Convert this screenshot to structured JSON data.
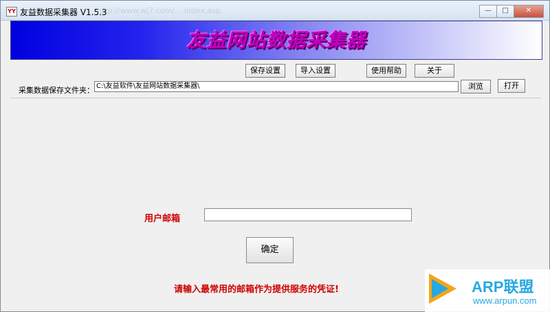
{
  "window": {
    "title": "友益数据采集器 V1.5.3",
    "title_ghost": "http://www.wj7.com/... index.asp",
    "minimize_glyph": "—",
    "maximize_glyph": "□",
    "close_glyph": "✕"
  },
  "banner": {
    "title": "友益网站数据采集器"
  },
  "toolbar": {
    "save_settings": "保存设置",
    "import_settings": "导入设置",
    "help": "使用帮助",
    "about": "关于"
  },
  "folder": {
    "label": "采集数据保存文件夹：",
    "path": "C:\\友益软件\\友益网站数据采集器\\",
    "browse": "浏览",
    "open": "打开"
  },
  "form": {
    "email_label": "用户邮箱",
    "email_value": "",
    "confirm": "确定",
    "notice": "请输入最常用的邮箱作为提供服务的凭证!"
  },
  "watermark": {
    "name": "ARP联盟",
    "url": "www.arpun.com"
  },
  "colors": {
    "banner_start": "#0000e0",
    "banner_title": "#c000c0",
    "accent_red": "#d00000"
  }
}
